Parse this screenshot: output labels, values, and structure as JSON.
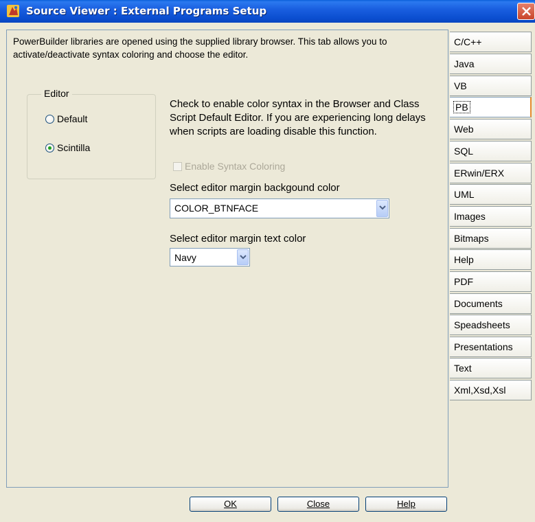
{
  "window": {
    "title": "Source Viewer : External Programs Setup",
    "icon": "powerbuilder-app-icon",
    "close_icon": "close-icon"
  },
  "description": "PowerBuilder libraries are opened using the supplied library browser. This tab allows you to activate/deactivate syntax coloring and choose the editor.",
  "editor_group": {
    "legend": "Editor",
    "options": [
      {
        "label": "Default",
        "selected": false
      },
      {
        "label": "Scintilla",
        "selected": true
      }
    ]
  },
  "syntax": {
    "info": "Check to enable color syntax in the Browser and Class Script Default Editor. If you are experiencing long delays when scripts are loading disable this function.",
    "checkbox_label": "Enable Syntax Coloring",
    "checked": false,
    "enabled": false
  },
  "margin_background": {
    "label": "Select editor margin backgound color",
    "value": "COLOR_BTNFACE"
  },
  "margin_text": {
    "label": "Select editor margin text color",
    "value": "Navy"
  },
  "tabs": [
    {
      "label": "C/C++"
    },
    {
      "label": "Java"
    },
    {
      "label": "VB"
    },
    {
      "label": "PB",
      "active": true
    },
    {
      "label": "Web"
    },
    {
      "label": "SQL"
    },
    {
      "label": "ERwin/ERX"
    },
    {
      "label": "UML"
    },
    {
      "label": "Images"
    },
    {
      "label": "Bitmaps"
    },
    {
      "label": "Help"
    },
    {
      "label": "PDF"
    },
    {
      "label": "Documents"
    },
    {
      "label": "Speadsheets"
    },
    {
      "label": "Presentations"
    },
    {
      "label": "Text"
    },
    {
      "label": "Xml,Xsd,Xsl"
    }
  ],
  "buttons": {
    "ok": "OK",
    "close": "Close",
    "help": "Help"
  },
  "colors": {
    "titlebar": "#0b4ed0",
    "face": "#ece9d8",
    "radio_dot": "#21a121",
    "active_tab_edge": "#e68b2c"
  }
}
